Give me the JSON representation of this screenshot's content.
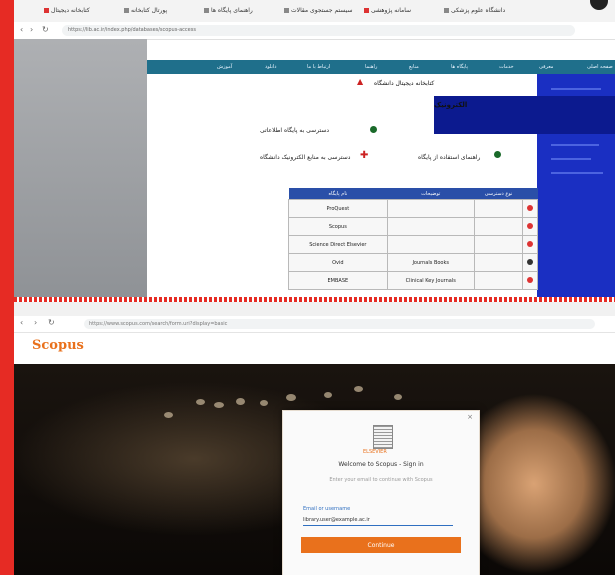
{
  "top_browser": {
    "tabs": [
      {
        "label": "دانشگاه علوم پزشکی"
      },
      {
        "label": "سامانه پژوهشی"
      },
      {
        "label": "سیستم جستجوی مقالات"
      },
      {
        "label": "راهنمای پایگاه ها"
      },
      {
        "label": "پورتال کتابخانه"
      },
      {
        "label": "کتابخانه دیجیتال"
      }
    ],
    "url": "https://lib.ac.ir/index.php/databases/scopus-access"
  },
  "site": {
    "nav_items": [
      "صفحه اصلی",
      "معرفی",
      "خدمات",
      "پایگاه ها",
      "منابع",
      "راهنما",
      "ارتباط با ما",
      "دانلود",
      "آموزش"
    ],
    "header_title": "کتابخانه دیجیتال دانشگاه",
    "section_title": "الکترونیک",
    "links": [
      {
        "label": "دسترسی به پایگاه اطلاعاتی"
      },
      {
        "label": "دسترسی به منابع الکترونیک دانشگاه"
      },
      {
        "label": "راهنمای استفاده از پایگاه"
      }
    ],
    "table": {
      "headers": [
        "نام پایگاه",
        "توضیحات",
        "نوع دسترسی",
        ""
      ],
      "rows": [
        {
          "name": "ProQuest",
          "desc": "",
          "type": ""
        },
        {
          "name": "Scopus",
          "desc": "",
          "type": ""
        },
        {
          "name": "Science Direct Elsevier",
          "desc": "",
          "type": ""
        },
        {
          "name": "Ovid",
          "desc": "Journals Books",
          "type": ""
        },
        {
          "name": "EMBASE",
          "desc": "Clinical Key Journals",
          "type": ""
        }
      ]
    }
  },
  "bottom_browser": {
    "url": "https://www.scopus.com/search/form.uri?display=basic",
    "logo": "Scopus",
    "login": {
      "publisher": "ELSEVIER",
      "heading": "Welcome to Scopus - Sign in",
      "subheading": "Enter your email to continue with Scopus",
      "email_label": "Email or username",
      "email_value": "library.user@example.ac.ir",
      "continue_label": "Continue",
      "close_glyph": "×"
    }
  },
  "colors": {
    "background": "#e62b24",
    "site_nav": "#1f6f8b",
    "dark_banner": "#0c1a8f",
    "scopus_orange": "#e9711c",
    "table_header": "#2a4fa8"
  }
}
